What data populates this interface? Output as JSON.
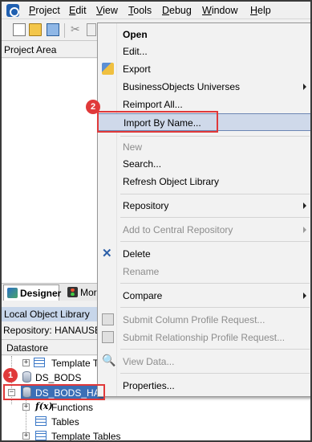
{
  "menubar": {
    "items": [
      {
        "label": "Project",
        "mnemonic_index": 0
      },
      {
        "label": "Edit",
        "mnemonic_index": 0
      },
      {
        "label": "View",
        "mnemonic_index": 0
      },
      {
        "label": "Tools",
        "mnemonic_index": 0
      },
      {
        "label": "Debug",
        "mnemonic_index": 0
      },
      {
        "label": "Window",
        "mnemonic_index": 0
      },
      {
        "label": "Help",
        "mnemonic_index": 0
      }
    ]
  },
  "project_area": {
    "title": "Project Area"
  },
  "tabs": {
    "designer": "Designer",
    "monitor": "Mor"
  },
  "local_object_library": {
    "title": "Local Object Library",
    "repository": "Repository: HANAUSER",
    "datastore_header": "Datastore",
    "tree": {
      "template_tables_top": "Template Ta",
      "ds_bods": "DS_BODS",
      "ds_bods_hana": "DS_BODS_HANA",
      "functions": "Functions",
      "tables": "Tables",
      "template_tables": "Template Tables"
    }
  },
  "context_menu": {
    "open": "Open",
    "edit": "Edit...",
    "export": "Export",
    "bo_universes": "BusinessObjects Universes",
    "reimport_all": "Reimport All...",
    "import_by_name": "Import By Name...",
    "new": "New",
    "search": "Search...",
    "refresh": "Refresh Object Library",
    "repository": "Repository",
    "add_to_central": "Add to Central Repository",
    "delete": "Delete",
    "rename": "Rename",
    "compare": "Compare",
    "submit_column": "Submit Column Profile Request...",
    "submit_relationship": "Submit Relationship Profile Request...",
    "view_data": "View Data...",
    "properties": "Properties..."
  },
  "annotations": {
    "step1": "1",
    "step2": "2",
    "highlight_color": "#e0393a"
  }
}
